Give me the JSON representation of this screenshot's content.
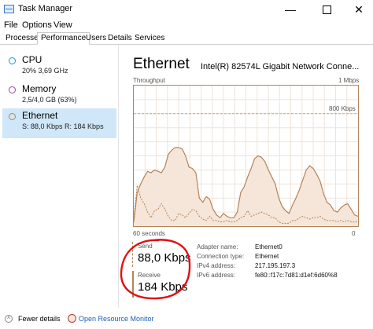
{
  "window": {
    "title": "Task Manager",
    "minimize_glyph": "—",
    "close_glyph": "✕"
  },
  "menu": [
    "File",
    "Options",
    "View"
  ],
  "tabs": [
    {
      "label": "Processes",
      "active": false
    },
    {
      "label": "Performance",
      "active": true
    },
    {
      "label": "Users",
      "active": false
    },
    {
      "label": "Details",
      "active": false
    },
    {
      "label": "Services",
      "active": false
    }
  ],
  "resources": [
    {
      "name": "CPU",
      "detail": "20% 3,69 GHz",
      "color": "#1f8ed6",
      "selected": false
    },
    {
      "name": "Memory",
      "detail": "2,5/4,0 GB (63%)",
      "color": "#9a3fb0",
      "selected": false
    },
    {
      "name": "Ethernet",
      "detail": "S: 88,0 Kbps R: 184 Kbps",
      "color": "#b38458",
      "selected": true
    }
  ],
  "main": {
    "heading": "Ethernet",
    "adapter": "Intel(R) 82574L Gigabit Network Conne...",
    "throughput_label": "Throughput",
    "max_label": "1 Mbps",
    "scale_label": "800 Kbps",
    "time_label": "60 seconds",
    "zero_label": "0",
    "graph_color": "#b38458",
    "graph_fill": "#f6e6d9"
  },
  "chart_data": {
    "type": "area",
    "ylim_kbps": [
      0,
      1000
    ],
    "series": [
      {
        "values": [
          30,
          240,
          300,
          350,
          390,
          380,
          400,
          390,
          380,
          420,
          510,
          540,
          560,
          560,
          550,
          500,
          420,
          410,
          380,
          200,
          170,
          210,
          190,
          120,
          80,
          60,
          90,
          70,
          60,
          60,
          100,
          240,
          280,
          350,
          410,
          480,
          500,
          490,
          460,
          400,
          350,
          300,
          200,
          140,
          110,
          90,
          150,
          200,
          260,
          330,
          400,
          430,
          410,
          370,
          320,
          230,
          170,
          150,
          110,
          100,
          130,
          150,
          160,
          120,
          80,
          70
        ]
      },
      {
        "values": [
          60,
          290,
          200,
          160,
          100,
          60,
          110,
          120,
          160,
          120,
          70,
          40,
          40,
          90,
          80,
          60,
          90,
          120,
          110,
          70,
          50,
          40,
          70,
          40,
          40,
          30,
          30,
          40,
          30,
          30,
          40,
          60,
          70,
          110,
          70,
          80,
          90,
          100,
          90,
          80,
          60,
          60,
          30,
          20,
          20,
          20,
          40,
          40,
          60,
          70,
          60,
          50,
          60,
          60,
          70,
          50,
          40,
          40,
          40,
          30,
          40,
          30,
          40,
          30,
          30,
          30
        ]
      }
    ]
  },
  "stats": {
    "send_label": "Send",
    "send_value": "88,0 Kbps",
    "receive_label": "Receive",
    "receive_value": "184 Kbps",
    "annotation_color": "#e01010"
  },
  "info": [
    {
      "label": "Adapter name:",
      "value": "Ethernet0"
    },
    {
      "label": "Connection type:",
      "value": "Ethernet"
    },
    {
      "label": "IPv4 address:",
      "value": "217.195.197.3"
    },
    {
      "label": "IPv6 address:",
      "value": "fe80::f17c:7d81:d1ef:6d60%8"
    }
  ],
  "footer": {
    "fewer_details": "Fewer details",
    "open_resmon": "Open Resource Monitor"
  }
}
